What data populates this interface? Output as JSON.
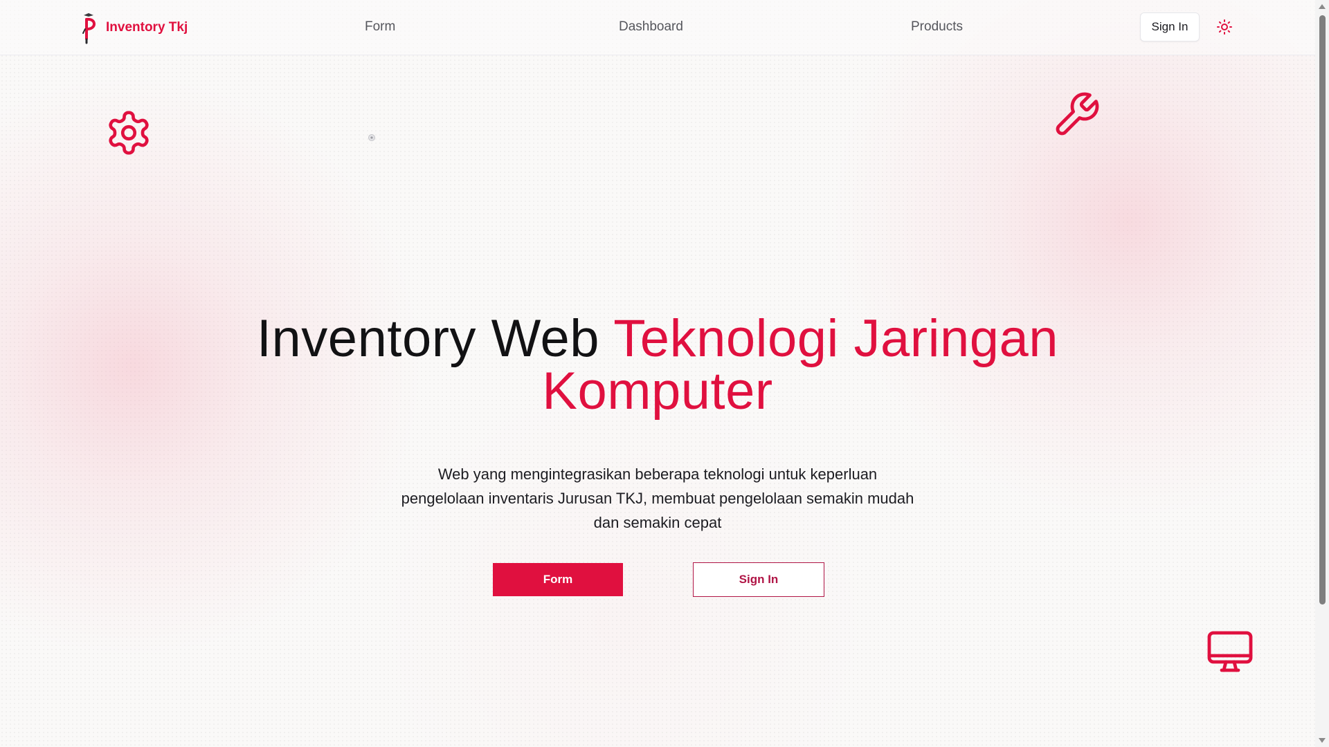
{
  "header": {
    "brand": "Inventory Tkj",
    "nav": {
      "form": "Form",
      "dashboard": "Dashboard",
      "products": "Products"
    },
    "sign_in": "Sign In",
    "theme_toggle_icon": "sun-icon"
  },
  "hero": {
    "title_plain": "Inventory Web",
    "title_accent": "Teknologi Jaringan Komputer",
    "description": "Web yang mengintegrasikan beberapa teknologi untuk keperluan pengelolaan inventaris Jurusan TKJ, membuat pengelolaan semakin mudah dan semakin cepat",
    "primary_button": "Form",
    "secondary_button": "Sign In"
  },
  "decorations": [
    "gear-icon",
    "wrench-icon",
    "monitor-icon"
  ],
  "colors": {
    "accent": "#e0103f",
    "secondary_accent": "#b01445",
    "background": "#faf9f8",
    "text": "#121214"
  }
}
